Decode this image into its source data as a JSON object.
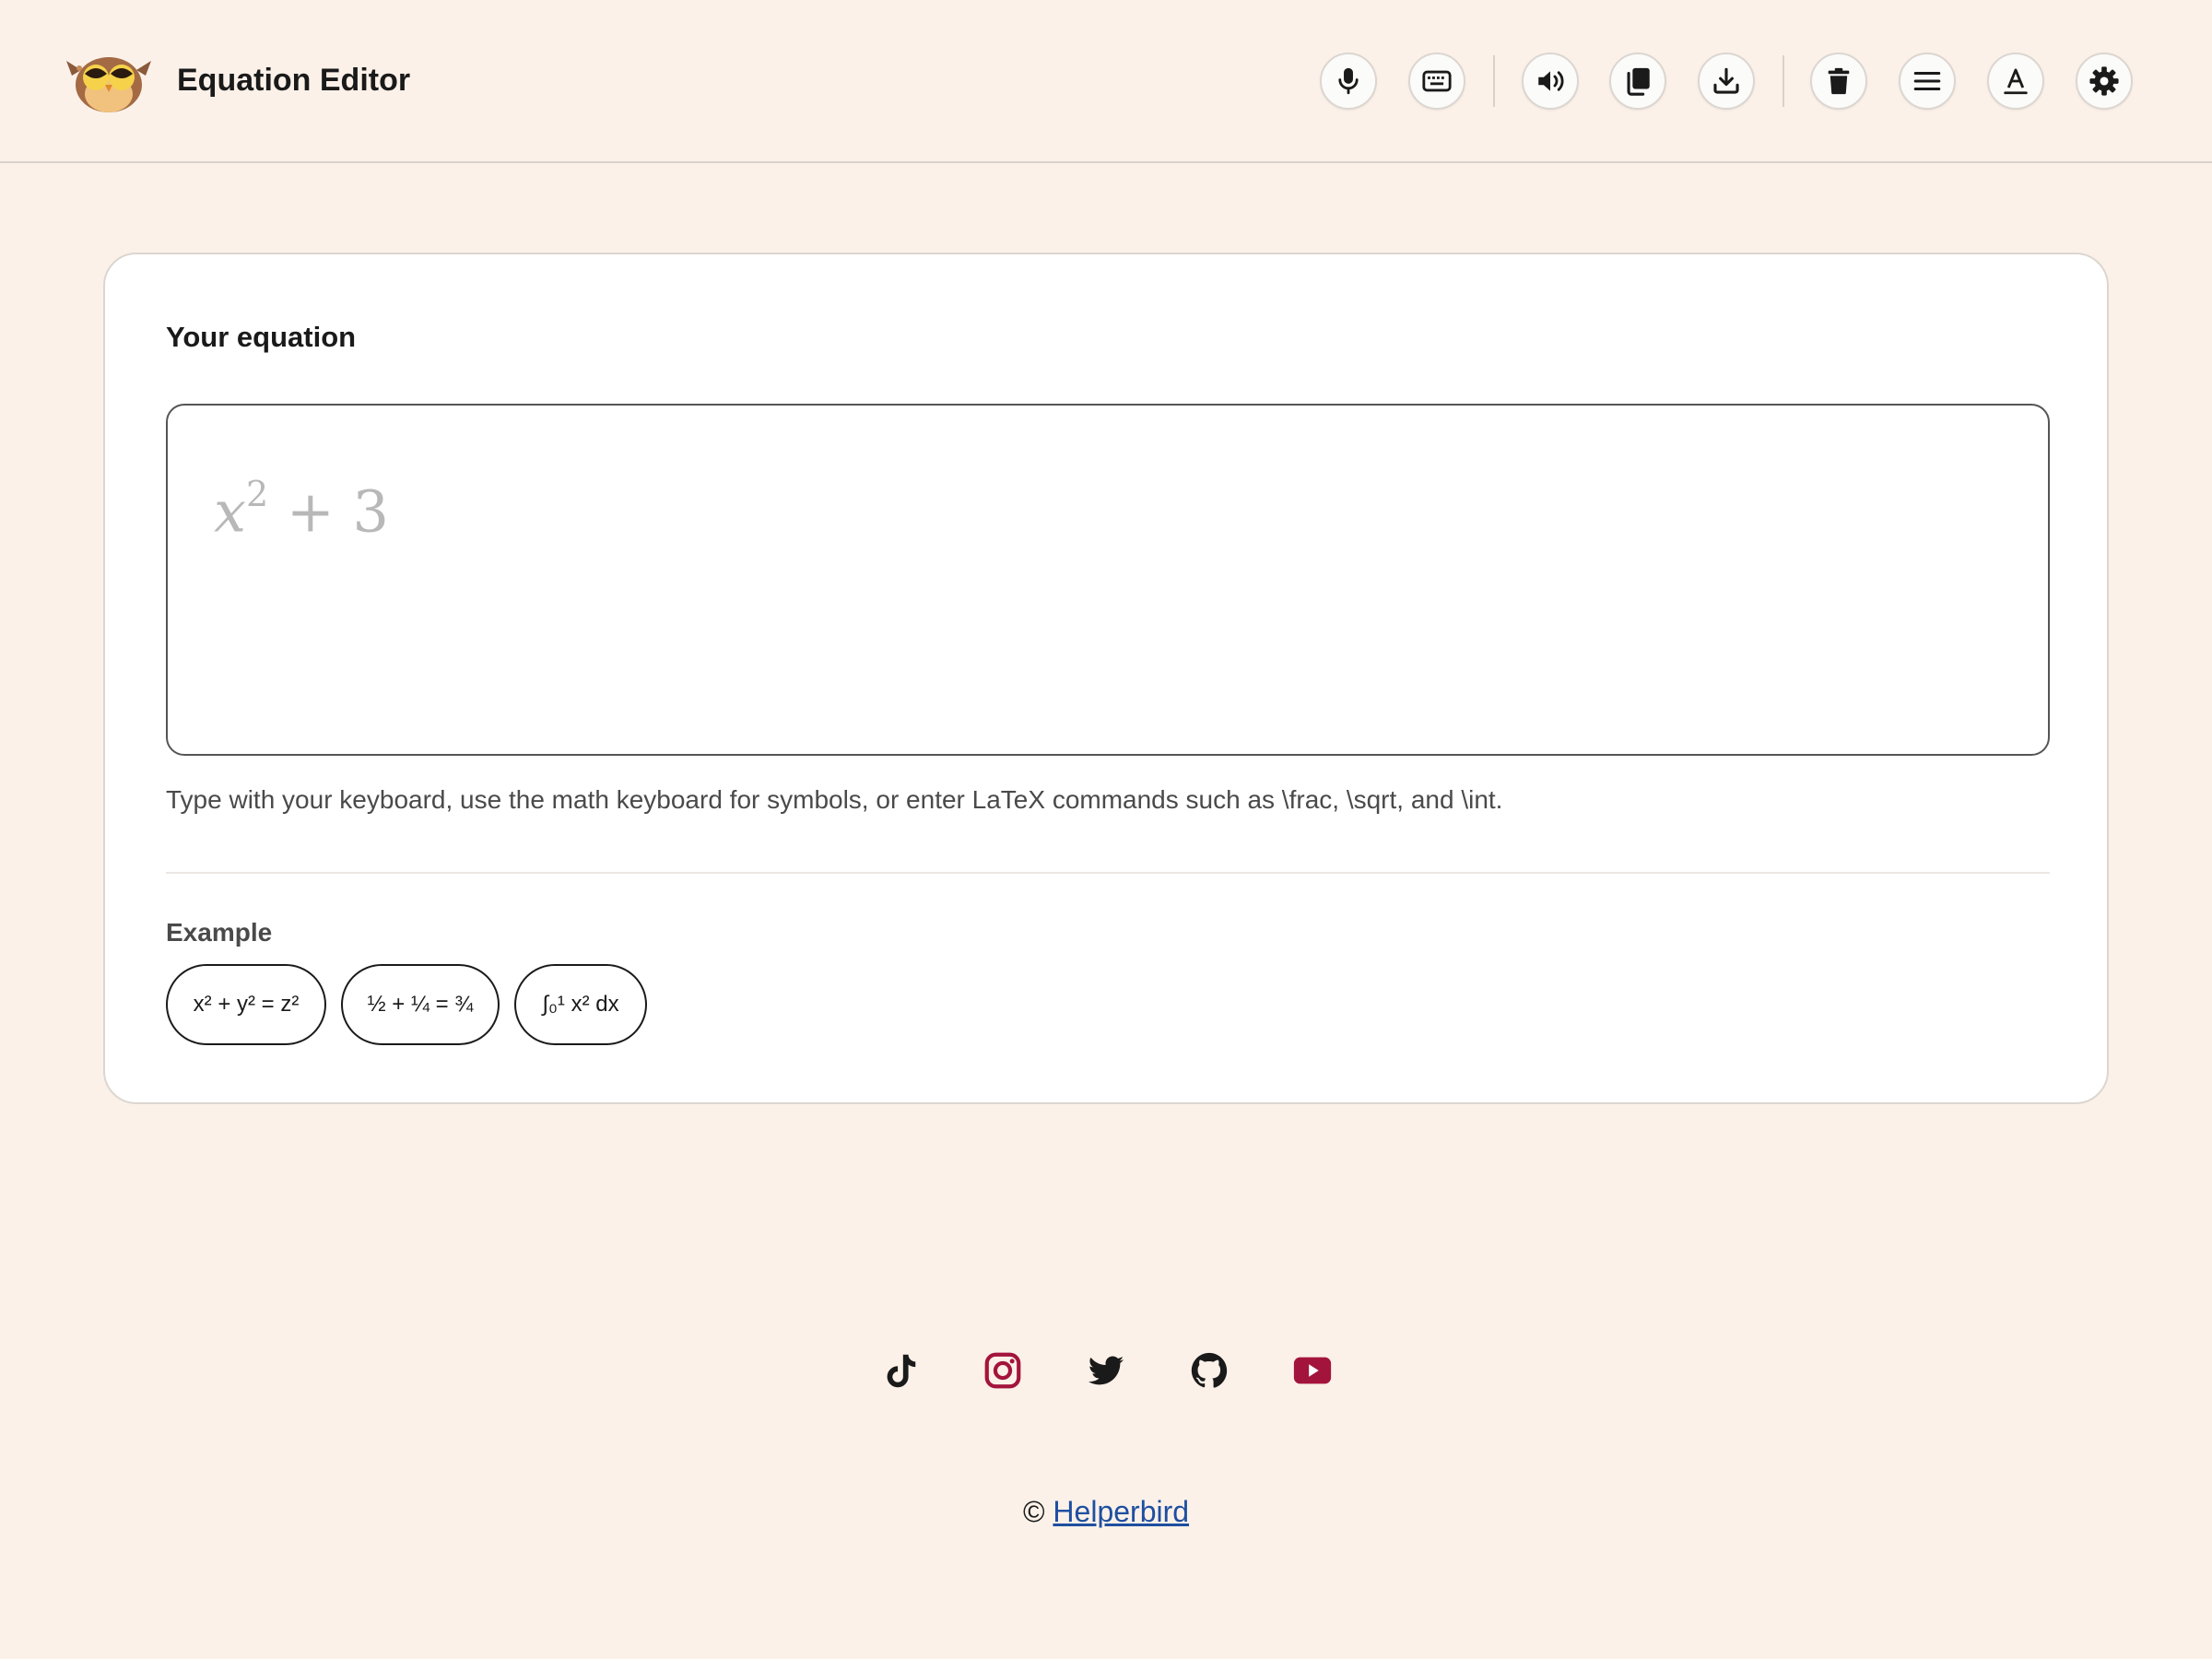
{
  "header": {
    "title": "Equation Editor",
    "logo_icon": "owl-logo-icon",
    "toolbar": [
      {
        "name": "microphone-button",
        "icon": "microphone-icon"
      },
      {
        "name": "keyboard-button",
        "icon": "keyboard-icon"
      },
      {
        "name": "speaker-button",
        "icon": "speaker-icon"
      },
      {
        "name": "copy-button",
        "icon": "copy-icon"
      },
      {
        "name": "download-button",
        "icon": "download-icon"
      },
      {
        "name": "delete-button",
        "icon": "trash-icon"
      },
      {
        "name": "menu-button",
        "icon": "menu-icon"
      },
      {
        "name": "font-button",
        "icon": "font-icon"
      },
      {
        "name": "settings-button",
        "icon": "gear-icon"
      }
    ]
  },
  "editor": {
    "title": "Your equation",
    "placeholder": {
      "base": "x",
      "exponent": "2",
      "rest": "+ 3"
    },
    "hint": "Type with your keyboard, use the math keyboard for symbols, or enter LaTeX commands such as \\frac, \\sqrt, and \\int."
  },
  "examples": {
    "label": "Example",
    "items": [
      "x² + y² = z²",
      "½ + ¼ = ¾",
      "∫₀¹ x² dx"
    ]
  },
  "footer": {
    "social": [
      "tiktok-icon",
      "instagram-icon",
      "twitter-icon",
      "github-icon",
      "youtube-icon"
    ],
    "copyright_symbol": "©",
    "copyright_link": "Helperbird"
  },
  "colors": {
    "background": "#fbf1e9",
    "accent": "#a3143c",
    "link": "#1e4fa0",
    "text": "#1a1a1a"
  }
}
